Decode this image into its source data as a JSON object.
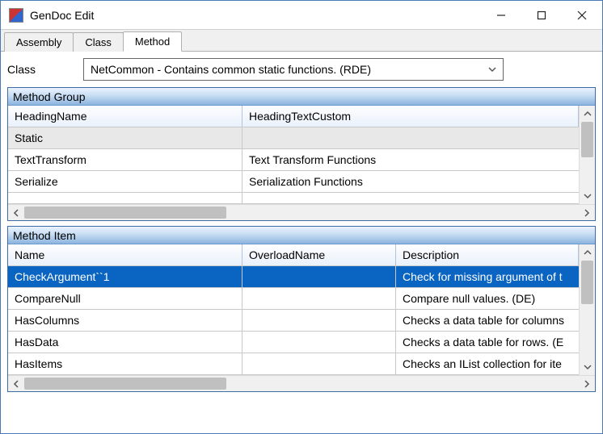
{
  "window": {
    "title": "GenDoc Edit"
  },
  "tabs": [
    {
      "label": "Assembly",
      "active": false
    },
    {
      "label": "Class",
      "active": false
    },
    {
      "label": "Method",
      "active": true
    }
  ],
  "class_field": {
    "label": "Class",
    "value": "NetCommon - Contains common static functions. (RDE)"
  },
  "method_group": {
    "title": "Method Group",
    "columns": [
      "HeadingName",
      "HeadingTextCustom"
    ],
    "rows": [
      {
        "name": "Static",
        "text": ""
      },
      {
        "name": "TextTransform",
        "text": "Text Transform Functions"
      },
      {
        "name": "Serialize",
        "text": "Serialization Functions"
      }
    ]
  },
  "method_item": {
    "title": "Method Item",
    "columns": [
      "Name",
      "OverloadName",
      "Description"
    ],
    "rows": [
      {
        "name": "CheckArgument``1",
        "over": "",
        "desc": "Check for missing argument of t",
        "selected": true
      },
      {
        "name": "CompareNull",
        "over": "",
        "desc": "Compare null values. (DE)",
        "selected": false
      },
      {
        "name": "HasColumns",
        "over": "",
        "desc": "Checks a data table for columns",
        "selected": false
      },
      {
        "name": "HasData",
        "over": "",
        "desc": "Checks a data table for rows. (E",
        "selected": false
      },
      {
        "name": "HasItems",
        "over": "",
        "desc": "Checks an IList collection for ite",
        "selected": false
      }
    ]
  }
}
